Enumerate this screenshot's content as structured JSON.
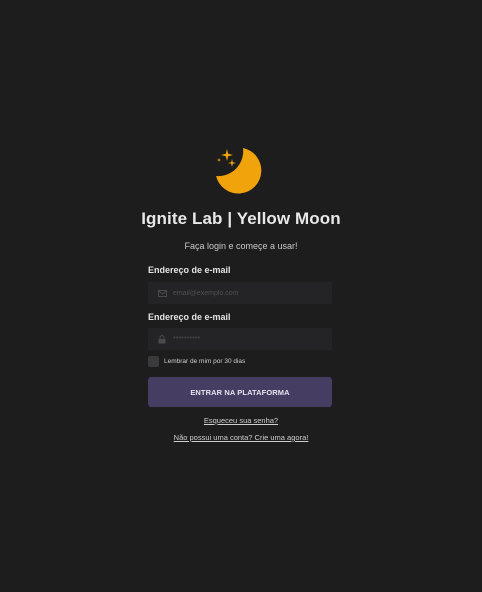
{
  "app": {
    "title": "Ignite Lab | Yellow Moon",
    "subtitle": "Faça login e começe a usar!",
    "accent_color": "#f0a30a",
    "logo_icon": "moon-stars-icon"
  },
  "form": {
    "email_label": "Endereço de e-mail",
    "email_placeholder": "email@exemplo.com",
    "email_value": "",
    "email_icon": "envelope-icon",
    "password_label": "Endereço de e-mail",
    "password_placeholder": "**********",
    "password_value": "",
    "password_icon": "lock-icon",
    "remember_label": "Lembrar de mim por 30 dias",
    "remember_checked": false,
    "submit_label": "ENTRAR NA PLATAFORMA",
    "submit_color": "#463e62"
  },
  "links": {
    "forgot": "Esqueceu sua senha?",
    "signup": "Não possui uma conta? Crie uma agora!"
  }
}
